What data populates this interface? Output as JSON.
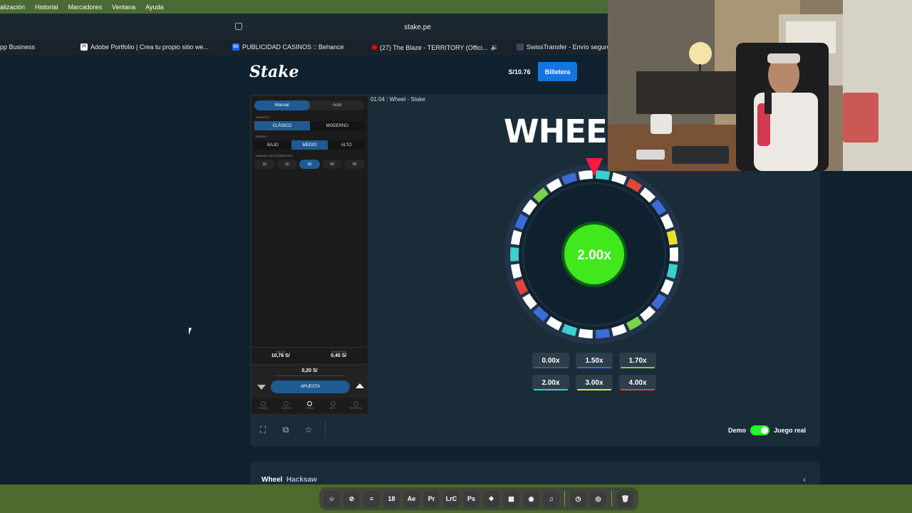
{
  "menubar": {
    "items": [
      "alización",
      "Historial",
      "Marcadores",
      "Ventana",
      "Ayuda"
    ]
  },
  "browser": {
    "url": "stake.pe",
    "tabs": [
      {
        "label": "pp Business",
        "icon": "none"
      },
      {
        "label": "Adobe Portfolio | Crea tu propio sitio we...",
        "icon": "adobe-portfolio-icon"
      },
      {
        "label": "PUBLICIDAD CASINOS :: Behance",
        "icon": "behance-icon"
      },
      {
        "label": "(27) The Blaze - TERRITORY (Offici...",
        "icon": "youtube-icon"
      },
      {
        "label": "SwissTransfer - Envío seguro",
        "icon": "swisstransfer-icon"
      }
    ]
  },
  "site": {
    "logo": "Stake",
    "balance": "S/10.76",
    "wallet_label": "Billetera"
  },
  "game": {
    "recording": "01:04",
    "title_window": "Wheel - Stake",
    "title": "WHEEL",
    "mode_manual": "Manual",
    "mode_auto": "Auto",
    "aspect_label": "ASPECTO",
    "aspect_classic": "CLÁSICO",
    "aspect_modern": "MODERNO",
    "risk_label": "RIESGO",
    "risk_low": "BAJO",
    "risk_medium": "MEDIO",
    "risk_high": "ALTO",
    "segments_label": "NÚMERO DE SEGMENTOS",
    "segments": [
      "10",
      "20",
      "30",
      "40",
      "50"
    ],
    "segments_selected": "30",
    "balance_label": "SALDO",
    "balance_value": "10,76 S/",
    "profit_label": "GANANCIA",
    "profit_value": "0,40 S/",
    "bet_amount": "0,20 S/",
    "bet_button": "APUESTA",
    "nav": [
      "SONIDO",
      "MÚSICA",
      "TURBO",
      "INFO",
      "HISTORIAL"
    ],
    "result": "2.00x",
    "multipliers": [
      {
        "label": "0.00x",
        "color": "#4c5b78"
      },
      {
        "label": "1.50x",
        "color": "#3d6cd6"
      },
      {
        "label": "1.70x",
        "color": "#79d34b"
      },
      {
        "label": "2.00x",
        "color": "#3ad0cc"
      },
      {
        "label": "3.00x",
        "color": "#e8e12b"
      },
      {
        "label": "4.00x",
        "color": "#e0453c"
      }
    ],
    "demo_label": "Demo",
    "real_label": "Juego real",
    "info_title": "Wheel",
    "info_provider": "Hacksaw"
  },
  "dock": {
    "items": [
      "finder-icon",
      "safari-icon",
      "notes-icon",
      "calendar-icon",
      "after-effects-icon",
      "premiere-icon",
      "lightroom-icon",
      "photoshop-icon",
      "figma-icon",
      "app-icon",
      "discord-icon",
      "music-icon",
      "recorder-icon",
      "screenshot-icon",
      "trash-icon"
    ],
    "calendar_day": "18",
    "ae": "Ae",
    "pr": "Pr",
    "lrc": "LrC",
    "ps": "Ps"
  }
}
